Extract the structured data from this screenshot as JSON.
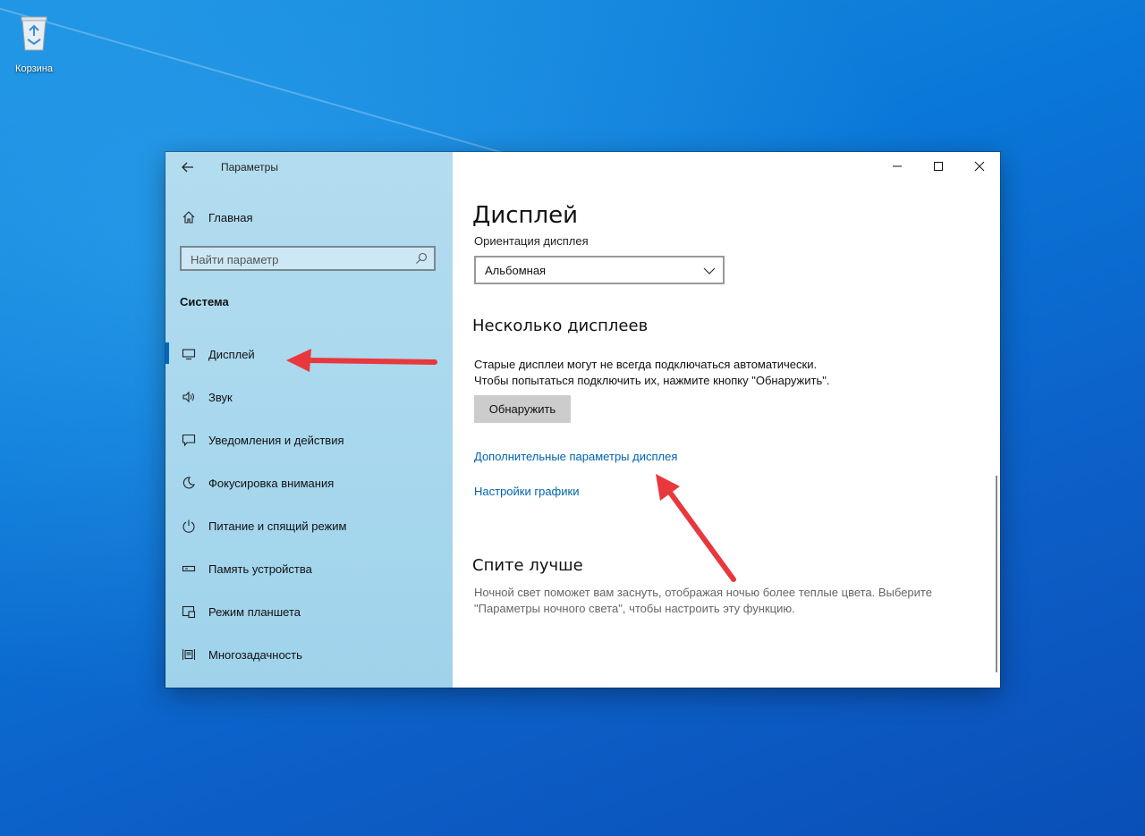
{
  "desktop": {
    "recycle_bin_label": "Корзина"
  },
  "window": {
    "app_title": "Параметры"
  },
  "sidebar": {
    "home_label": "Главная",
    "search_placeholder": "Найти параметр",
    "section_heading": "Система",
    "items": [
      {
        "label": "Дисплей",
        "icon": "monitor-icon"
      },
      {
        "label": "Звук",
        "icon": "speaker-icon"
      },
      {
        "label": "Уведомления и действия",
        "icon": "notification-icon"
      },
      {
        "label": "Фокусировка внимания",
        "icon": "moon-icon"
      },
      {
        "label": "Питание и спящий режим",
        "icon": "power-icon"
      },
      {
        "label": "Память устройства",
        "icon": "storage-icon"
      },
      {
        "label": "Режим планшета",
        "icon": "tablet-icon"
      },
      {
        "label": "Многозадачность",
        "icon": "multitask-icon"
      }
    ]
  },
  "main": {
    "title": "Дисплей",
    "orientation_label": "Ориентация дисплея",
    "orientation_value": "Альбомная",
    "multi_heading": "Несколько дисплеев",
    "multi_desc_line1": "Старые дисплеи могут не всегда подключаться автоматически.",
    "multi_desc_line2": "Чтобы попытаться подключить их, нажмите кнопку \"Обнаружить\".",
    "detect_button": "Обнаружить",
    "link_advanced": "Дополнительные параметры дисплея",
    "link_graphics": "Настройки графики",
    "sleep_heading": "Спите лучше",
    "sleep_desc": "Ночной свет поможет вам заснуть, отображая ночью более теплые цвета. Выберите \"Параметры ночного света\", чтобы настроить эту функцию."
  },
  "colors": {
    "accent": "#0067c0",
    "link": "#0063b1",
    "annotation_arrow": "#e8383d"
  }
}
